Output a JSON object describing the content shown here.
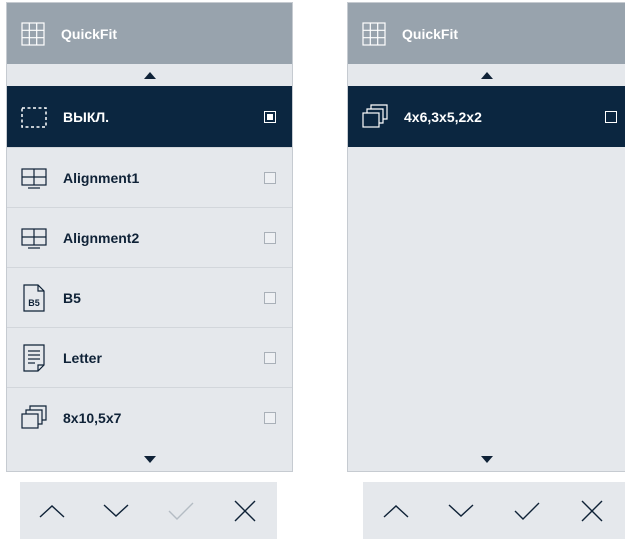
{
  "left_panel": {
    "header": {
      "title": "QuickFit",
      "icon": "grid-icon"
    },
    "items": [
      {
        "label": "ВЫКЛ.",
        "icon": "dashed-frame-icon",
        "selected": true,
        "checked": true
      },
      {
        "label": "Alignment1",
        "icon": "monitor-layout-icon",
        "selected": false,
        "checked": false
      },
      {
        "label": "Alignment2",
        "icon": "monitor-layout-icon",
        "selected": false,
        "checked": false
      },
      {
        "label": "B5",
        "icon": "b5-document-icon",
        "badge": "B5",
        "selected": false,
        "checked": false
      },
      {
        "label": "Letter",
        "icon": "letter-document-icon",
        "selected": false,
        "checked": false
      },
      {
        "label": "8x10,5x7",
        "icon": "stacked-photos-icon",
        "selected": false,
        "checked": false
      }
    ]
  },
  "right_panel": {
    "header": {
      "title": "QuickFit",
      "icon": "grid-icon"
    },
    "items": [
      {
        "label": "4x6,3x5,2x2",
        "icon": "stacked-photos-icon",
        "selected": true,
        "checked": false
      }
    ]
  },
  "left_nav": {
    "up": "chevron-up-icon",
    "down": "chevron-down-icon",
    "ok": "check-icon",
    "ok_enabled": false,
    "cancel": "close-icon"
  },
  "right_nav": {
    "up": "chevron-up-icon",
    "down": "chevron-down-icon",
    "ok": "check-icon",
    "ok_enabled": true,
    "cancel": "close-icon"
  },
  "colors": {
    "header_bg": "#98a3ad",
    "panel_bg": "#e5e8ec",
    "selected_bg": "#0b2640",
    "text": "#0f2237",
    "disabled": "#b4bcc4"
  }
}
